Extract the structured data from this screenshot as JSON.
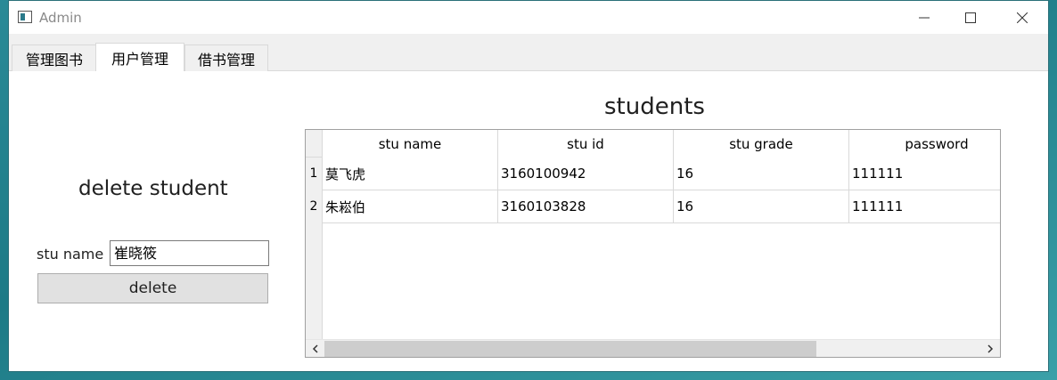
{
  "window": {
    "title": "Admin"
  },
  "tabs": [
    {
      "label": "管理图书"
    },
    {
      "label": "用户管理",
      "active": true
    },
    {
      "label": "借书管理"
    }
  ],
  "delete_panel": {
    "title": "delete student",
    "stu_name_label": "stu name",
    "stu_name_value": "崔晓筱",
    "delete_label": "delete"
  },
  "table": {
    "title": "students",
    "columns": [
      "stu name",
      "stu id",
      "stu grade",
      "password"
    ],
    "row_numbers": [
      "1",
      "2"
    ],
    "rows": [
      [
        "莫飞虎",
        "3160100942",
        "16",
        "111111"
      ],
      [
        "朱崧伯",
        "3160103828",
        "16",
        "111111"
      ]
    ]
  },
  "colors": {
    "background": "#2a8a97",
    "button": "#e1e1e1",
    "tabbar": "#f0f0f0"
  },
  "icons": [
    "app-window-icon",
    "minimize-icon",
    "maximize-icon",
    "close-icon",
    "chevron-left-icon",
    "chevron-right-icon"
  ]
}
